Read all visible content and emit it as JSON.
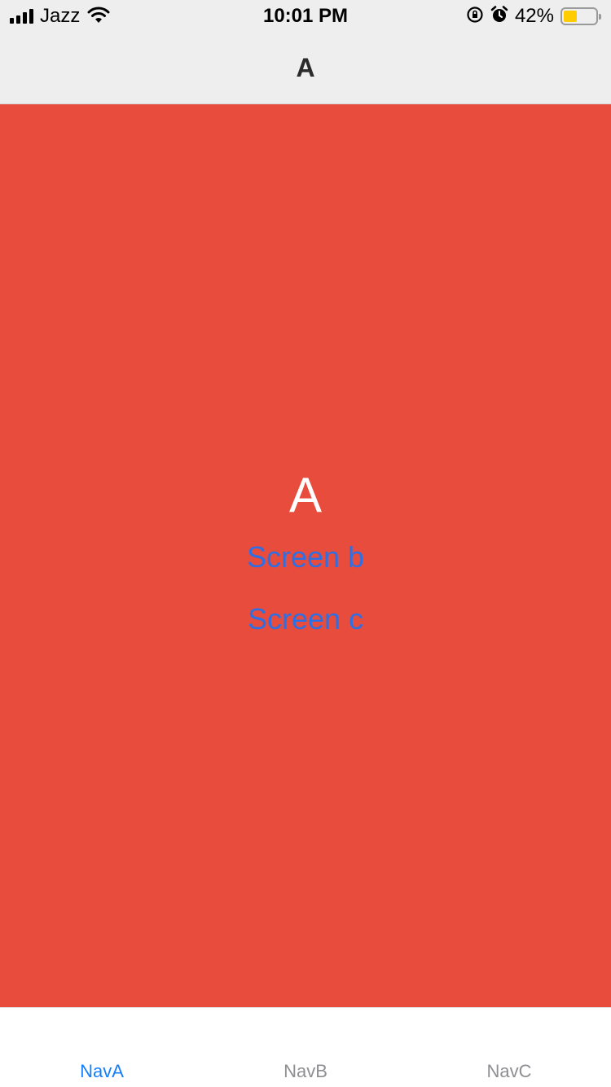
{
  "status_bar": {
    "carrier": "Jazz",
    "time": "10:01 PM",
    "battery_percent": "42%",
    "battery_level": 0.42,
    "icons": [
      "signal-icon",
      "wifi-icon",
      "orientation-lock-icon",
      "alarm-icon",
      "battery-icon"
    ]
  },
  "header": {
    "title": "A"
  },
  "screen": {
    "background_color": "#e74c3c",
    "title": "A",
    "links": [
      "Screen b",
      "Screen c"
    ],
    "link_color": "#2f6fe4"
  },
  "tabs": {
    "items": [
      {
        "label": "NavA",
        "active": true
      },
      {
        "label": "NavB",
        "active": false
      },
      {
        "label": "NavC",
        "active": false
      }
    ],
    "active_color": "#147efb",
    "inactive_color": "#8e8e93"
  }
}
